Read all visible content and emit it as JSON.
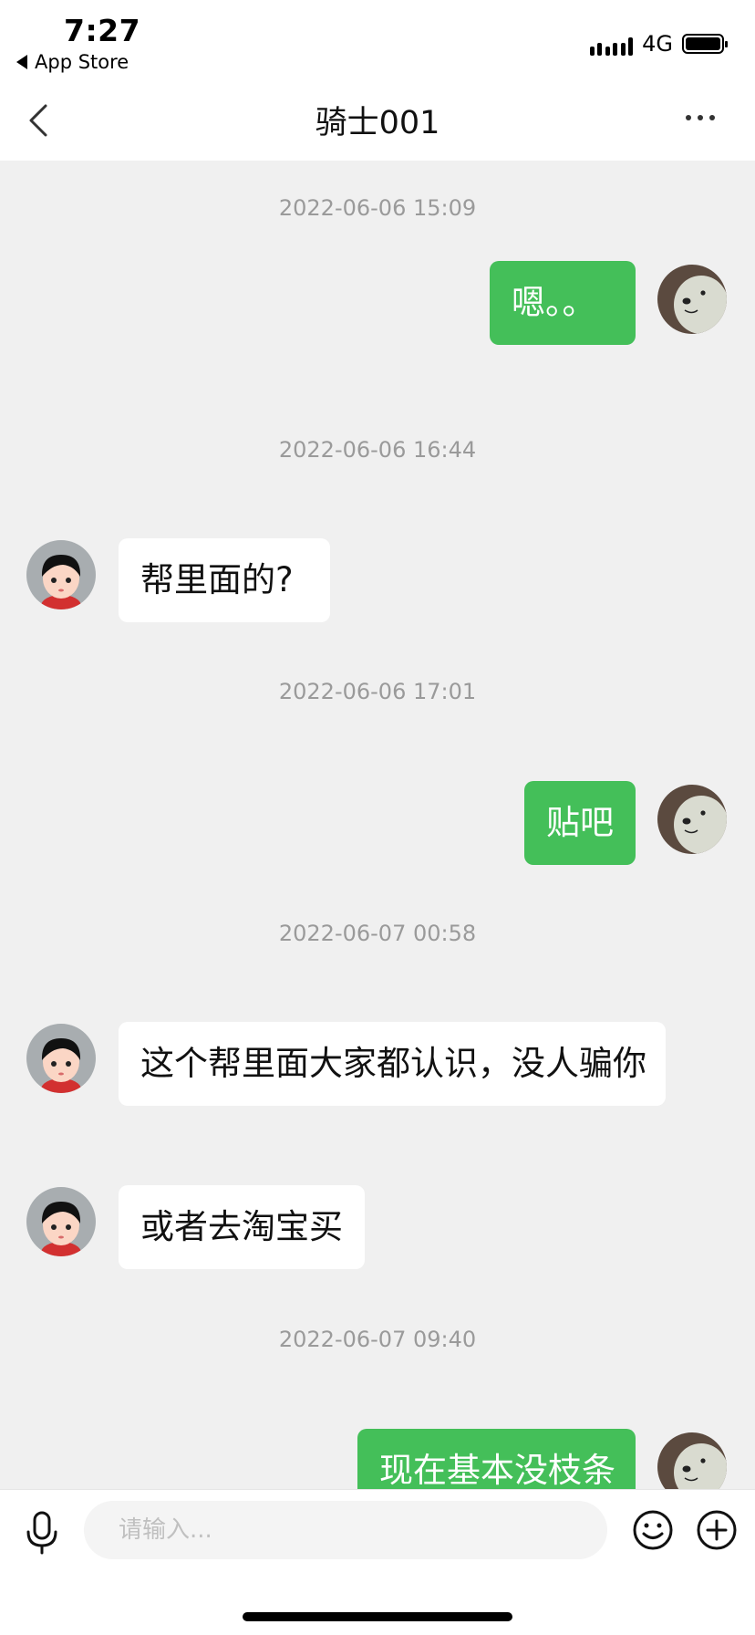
{
  "status_bar": {
    "time": "7:27",
    "back_app": "App Store",
    "network": "4G"
  },
  "nav": {
    "title": "骑士001"
  },
  "messages": [
    {
      "type": "timestamp",
      "text": "2022-06-06 15:09"
    },
    {
      "type": "message",
      "direction": "outgoing",
      "text": "嗯。。"
    },
    {
      "type": "timestamp",
      "text": "2022-06-06 16:44"
    },
    {
      "type": "message",
      "direction": "incoming",
      "text": "帮里面的?"
    },
    {
      "type": "timestamp",
      "text": "2022-06-06 17:01"
    },
    {
      "type": "message",
      "direction": "outgoing",
      "text": "贴吧"
    },
    {
      "type": "timestamp",
      "text": "2022-06-07 00:58"
    },
    {
      "type": "message",
      "direction": "incoming",
      "text": "这个帮里面大家都认识，没人骗你"
    },
    {
      "type": "message",
      "direction": "incoming",
      "text": "或者去淘宝买"
    },
    {
      "type": "timestamp",
      "text": "2022-06-07 09:40"
    },
    {
      "type": "message",
      "direction": "outgoing",
      "text": "现在基本没枝条"
    }
  ],
  "input": {
    "placeholder": "请输入..."
  },
  "colors": {
    "outgoing_bubble": "#44bf59",
    "incoming_bubble": "#ffffff",
    "chat_background": "#f0f0f0",
    "timestamp_text": "#9a9a9a"
  },
  "icons": {
    "nav_back": "chevron-left-icon",
    "nav_more": "more-dots-icon",
    "mic": "microphone-icon",
    "emoji": "smiley-icon",
    "plus": "plus-circle-icon"
  }
}
